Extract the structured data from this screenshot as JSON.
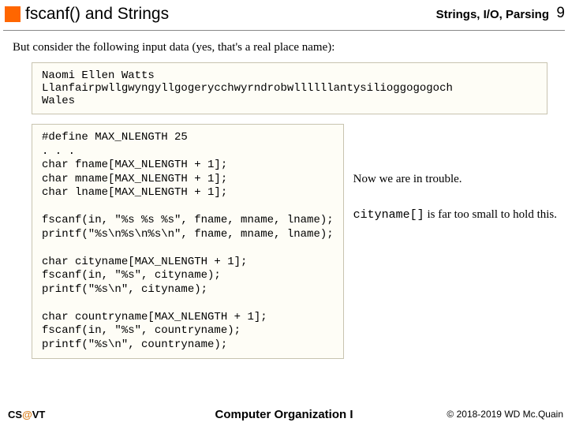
{
  "header": {
    "title": "fscanf() and Strings",
    "section": "Strings, I/O, Parsing",
    "page": "9"
  },
  "intro": "But consider the following input data (yes, that's a real place name):",
  "input_data": "Naomi Ellen Watts\nLlanfairpwllgwyngyllgogerycchwyrndrobwllllllantysilioggogogoch\nWales",
  "code": "#define MAX_NLENGTH 25\n. . .\nchar fname[MAX_NLENGTH + 1];\nchar mname[MAX_NLENGTH + 1];\nchar lname[MAX_NLENGTH + 1];\n\nfscanf(in, \"%s %s %s\", fname, mname, lname);\nprintf(\"%s\\n%s\\n%s\\n\", fname, mname, lname);\n\nchar cityname[MAX_NLENGTH + 1];\nfscanf(in, \"%s\", cityname);\nprintf(\"%s\\n\", cityname);\n\nchar countryname[MAX_NLENGTH + 1];\nfscanf(in, \"%s\", countryname);\nprintf(\"%s\\n\", countryname);",
  "notes": {
    "trouble": "Now we are in trouble.",
    "cityname_pre": "cityname[]",
    "cityname_post": " is far too small to hold this."
  },
  "footer": {
    "left_pre": "CS",
    "left_at": "@",
    "left_post": "VT",
    "center": "Computer Organization I",
    "right": "© 2018-2019 WD Mc.Quain"
  }
}
